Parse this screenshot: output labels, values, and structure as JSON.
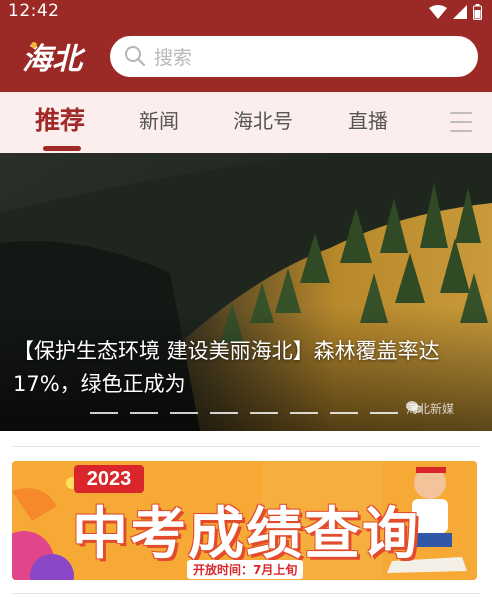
{
  "status_bar": {
    "time": "12:42"
  },
  "header": {
    "logo_text": "海北",
    "search_placeholder": "搜索"
  },
  "tabs": [
    {
      "label": "推荐",
      "active": true
    },
    {
      "label": "新闻",
      "active": false
    },
    {
      "label": "海北号",
      "active": false
    },
    {
      "label": "直播",
      "active": false
    }
  ],
  "hero": {
    "caption": "【保护生态环境  建设美丽海北】森林覆盖率达17%，绿色正成为",
    "slide_count": 8,
    "watermark": "海北新媒"
  },
  "banner": {
    "year": "2023",
    "title": "中考成绩查询",
    "open_time": "开放时间：7月上旬"
  },
  "colors": {
    "brand": "#9b2a27",
    "tab_bg": "#fbeeed",
    "active_tab": "#a02a27",
    "banner_orange": "#f7b13d"
  }
}
